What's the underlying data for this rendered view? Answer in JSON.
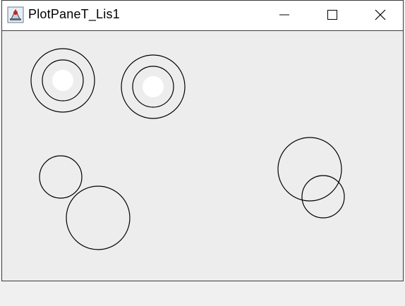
{
  "window": {
    "title": "PlotPaneT_Lis1",
    "app_icon": "java-app-icon",
    "controls": [
      "minimize-icon",
      "maximize-icon",
      "close-icon"
    ]
  },
  "canvas": {
    "background": "#ededed",
    "stroke": "#000000",
    "fill_highlight": "#ffffff"
  }
}
